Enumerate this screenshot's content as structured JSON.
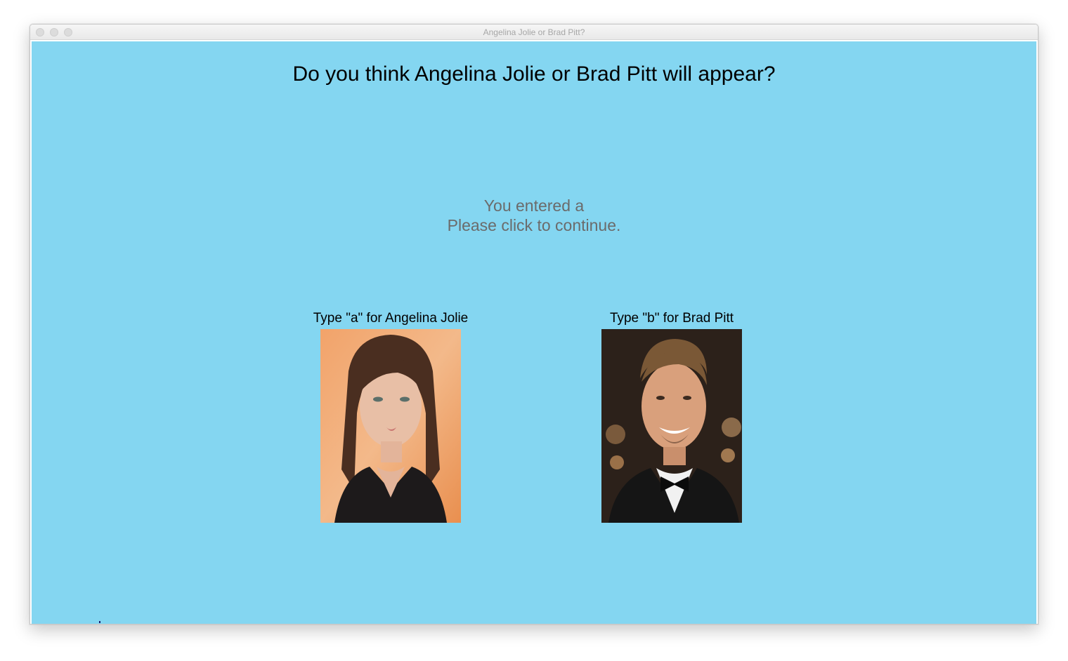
{
  "window": {
    "title": "Angelina Jolie or Brad Pitt?"
  },
  "prompt": {
    "question": "Do you think Angelina Jolie or Brad Pitt will appear?"
  },
  "status": {
    "line1": "You entered a",
    "line2": "Please click to continue."
  },
  "choices": [
    {
      "label": "Type \"a\" for Angelina Jolie",
      "photo_icon": "angelina-jolie-photo"
    },
    {
      "label": "Type \"b\" for Brad Pitt",
      "photo_icon": "brad-pitt-photo"
    }
  ],
  "colors": {
    "background": "#84d6f1",
    "status_text": "#6b6b6b"
  }
}
